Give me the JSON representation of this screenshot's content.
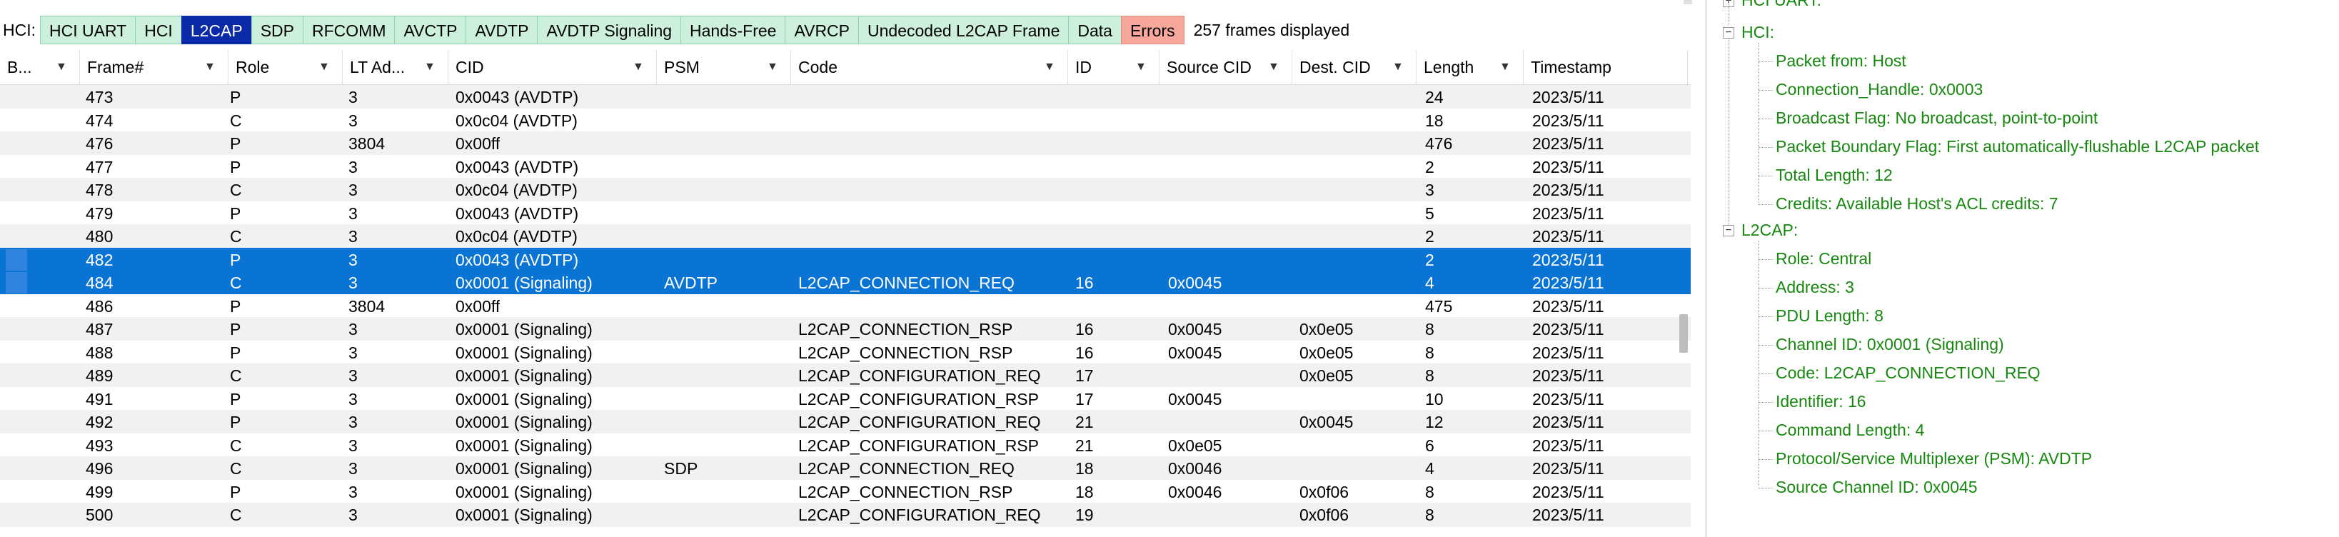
{
  "tabbar": {
    "hci_label": "HCI:",
    "tabs": [
      {
        "label": "HCI UART",
        "selected": false
      },
      {
        "label": "HCI",
        "selected": false
      },
      {
        "label": "L2CAP",
        "selected": true
      },
      {
        "label": "SDP",
        "selected": false
      },
      {
        "label": "RFCOMM",
        "selected": false
      },
      {
        "label": "AVCTP",
        "selected": false
      },
      {
        "label": "AVDTP",
        "selected": false
      },
      {
        "label": "AVDTP Signaling",
        "selected": false
      },
      {
        "label": "Hands-Free",
        "selected": false
      },
      {
        "label": "AVRCP",
        "selected": false
      },
      {
        "label": "Undecoded L2CAP Frame",
        "selected": false
      },
      {
        "label": "Data",
        "selected": false
      },
      {
        "label": "Errors",
        "selected": false
      }
    ],
    "frames_count": "257 frames displayed"
  },
  "table": {
    "columns": [
      "B...",
      "Frame#",
      "Role",
      "LT Ad...",
      "CID",
      "PSM",
      "Code",
      "ID",
      "Source CID",
      "Dest. CID",
      "Length",
      "Timestamp"
    ],
    "rows": [
      {
        "frame": "473",
        "role": "P",
        "lt": "3",
        "cid": "0x0043 (AVDTP)",
        "psm": "",
        "code": "",
        "id": "",
        "src": "",
        "dst": "",
        "len": "24",
        "ts": "2023/5/11",
        "selected": false
      },
      {
        "frame": "474",
        "role": "C",
        "lt": "3",
        "cid": "0x0c04 (AVDTP)",
        "psm": "",
        "code": "",
        "id": "",
        "src": "",
        "dst": "",
        "len": "18",
        "ts": "2023/5/11",
        "selected": false
      },
      {
        "frame": "476",
        "role": "P",
        "lt": "3804",
        "cid": "0x00ff",
        "psm": "",
        "code": "",
        "id": "",
        "src": "",
        "dst": "",
        "len": "476",
        "ts": "2023/5/11",
        "selected": false
      },
      {
        "frame": "477",
        "role": "P",
        "lt": "3",
        "cid": "0x0043 (AVDTP)",
        "psm": "",
        "code": "",
        "id": "",
        "src": "",
        "dst": "",
        "len": "2",
        "ts": "2023/5/11",
        "selected": false
      },
      {
        "frame": "478",
        "role": "C",
        "lt": "3",
        "cid": "0x0c04 (AVDTP)",
        "psm": "",
        "code": "",
        "id": "",
        "src": "",
        "dst": "",
        "len": "3",
        "ts": "2023/5/11",
        "selected": false
      },
      {
        "frame": "479",
        "role": "P",
        "lt": "3",
        "cid": "0x0043 (AVDTP)",
        "psm": "",
        "code": "",
        "id": "",
        "src": "",
        "dst": "",
        "len": "5",
        "ts": "2023/5/11",
        "selected": false
      },
      {
        "frame": "480",
        "role": "C",
        "lt": "3",
        "cid": "0x0c04 (AVDTP)",
        "psm": "",
        "code": "",
        "id": "",
        "src": "",
        "dst": "",
        "len": "2",
        "ts": "2023/5/11",
        "selected": false
      },
      {
        "frame": "482",
        "role": "P",
        "lt": "3",
        "cid": "0x0043 (AVDTP)",
        "psm": "",
        "code": "",
        "id": "",
        "src": "",
        "dst": "",
        "len": "2",
        "ts": "2023/5/11",
        "selected": true
      },
      {
        "frame": "484",
        "role": "C",
        "lt": "3",
        "cid": "0x0001 (Signaling)",
        "psm": "AVDTP",
        "code": "L2CAP_CONNECTION_REQ",
        "id": "16",
        "src": "0x0045",
        "dst": "",
        "len": "4",
        "ts": "2023/5/11",
        "selected": true
      },
      {
        "frame": "486",
        "role": "P",
        "lt": "3804",
        "cid": "0x00ff",
        "psm": "",
        "code": "",
        "id": "",
        "src": "",
        "dst": "",
        "len": "475",
        "ts": "2023/5/11",
        "selected": false
      },
      {
        "frame": "487",
        "role": "P",
        "lt": "3",
        "cid": "0x0001 (Signaling)",
        "psm": "",
        "code": "L2CAP_CONNECTION_RSP",
        "id": "16",
        "src": "0x0045",
        "dst": "0x0e05",
        "len": "8",
        "ts": "2023/5/11",
        "selected": false
      },
      {
        "frame": "488",
        "role": "P",
        "lt": "3",
        "cid": "0x0001 (Signaling)",
        "psm": "",
        "code": "L2CAP_CONNECTION_RSP",
        "id": "16",
        "src": "0x0045",
        "dst": "0x0e05",
        "len": "8",
        "ts": "2023/5/11",
        "selected": false
      },
      {
        "frame": "489",
        "role": "C",
        "lt": "3",
        "cid": "0x0001 (Signaling)",
        "psm": "",
        "code": "L2CAP_CONFIGURATION_REQ",
        "id": "17",
        "src": "",
        "dst": "0x0e05",
        "len": "8",
        "ts": "2023/5/11",
        "selected": false
      },
      {
        "frame": "491",
        "role": "P",
        "lt": "3",
        "cid": "0x0001 (Signaling)",
        "psm": "",
        "code": "L2CAP_CONFIGURATION_RSP",
        "id": "17",
        "src": "0x0045",
        "dst": "",
        "len": "10",
        "ts": "2023/5/11",
        "selected": false
      },
      {
        "frame": "492",
        "role": "P",
        "lt": "3",
        "cid": "0x0001 (Signaling)",
        "psm": "",
        "code": "L2CAP_CONFIGURATION_REQ",
        "id": "21",
        "src": "",
        "dst": "0x0045",
        "len": "12",
        "ts": "2023/5/11",
        "selected": false
      },
      {
        "frame": "493",
        "role": "C",
        "lt": "3",
        "cid": "0x0001 (Signaling)",
        "psm": "",
        "code": "L2CAP_CONFIGURATION_RSP",
        "id": "21",
        "src": "0x0e05",
        "dst": "",
        "len": "6",
        "ts": "2023/5/11",
        "selected": false
      },
      {
        "frame": "496",
        "role": "C",
        "lt": "3",
        "cid": "0x0001 (Signaling)",
        "psm": "SDP",
        "code": "L2CAP_CONNECTION_REQ",
        "id": "18",
        "src": "0x0046",
        "dst": "",
        "len": "4",
        "ts": "2023/5/11",
        "selected": false
      },
      {
        "frame": "499",
        "role": "P",
        "lt": "3",
        "cid": "0x0001 (Signaling)",
        "psm": "",
        "code": "L2CAP_CONNECTION_RSP",
        "id": "18",
        "src": "0x0046",
        "dst": "0x0f06",
        "len": "8",
        "ts": "2023/5/11",
        "selected": false
      },
      {
        "frame": "500",
        "role": "C",
        "lt": "3",
        "cid": "0x0001 (Signaling)",
        "psm": "",
        "code": "L2CAP_CONFIGURATION_REQ",
        "id": "19",
        "src": "",
        "dst": "0x0f06",
        "len": "8",
        "ts": "2023/5/11",
        "selected": false
      }
    ]
  },
  "tree": {
    "hci_uart_label": "HCI UART:",
    "hci": {
      "label": "HCI:",
      "children": [
        "Packet from: Host",
        "Connection_Handle: 0x0003",
        "Broadcast Flag: No broadcast, point-to-point",
        "Packet Boundary Flag: First automatically-flushable L2CAP packet",
        "Total Length: 12",
        "Credits: Available Host's ACL credits: 7"
      ]
    },
    "l2cap": {
      "label": "L2CAP:",
      "children": [
        "Role: Central",
        "Address: 3",
        "PDU Length: 8",
        "Channel ID: 0x0001  (Signaling)",
        "Code: L2CAP_CONNECTION_REQ",
        "Identifier: 16",
        "Command Length: 4",
        "Protocol/Service Multiplexer (PSM): AVDTP",
        "Source Channel ID: 0x0045"
      ]
    }
  }
}
